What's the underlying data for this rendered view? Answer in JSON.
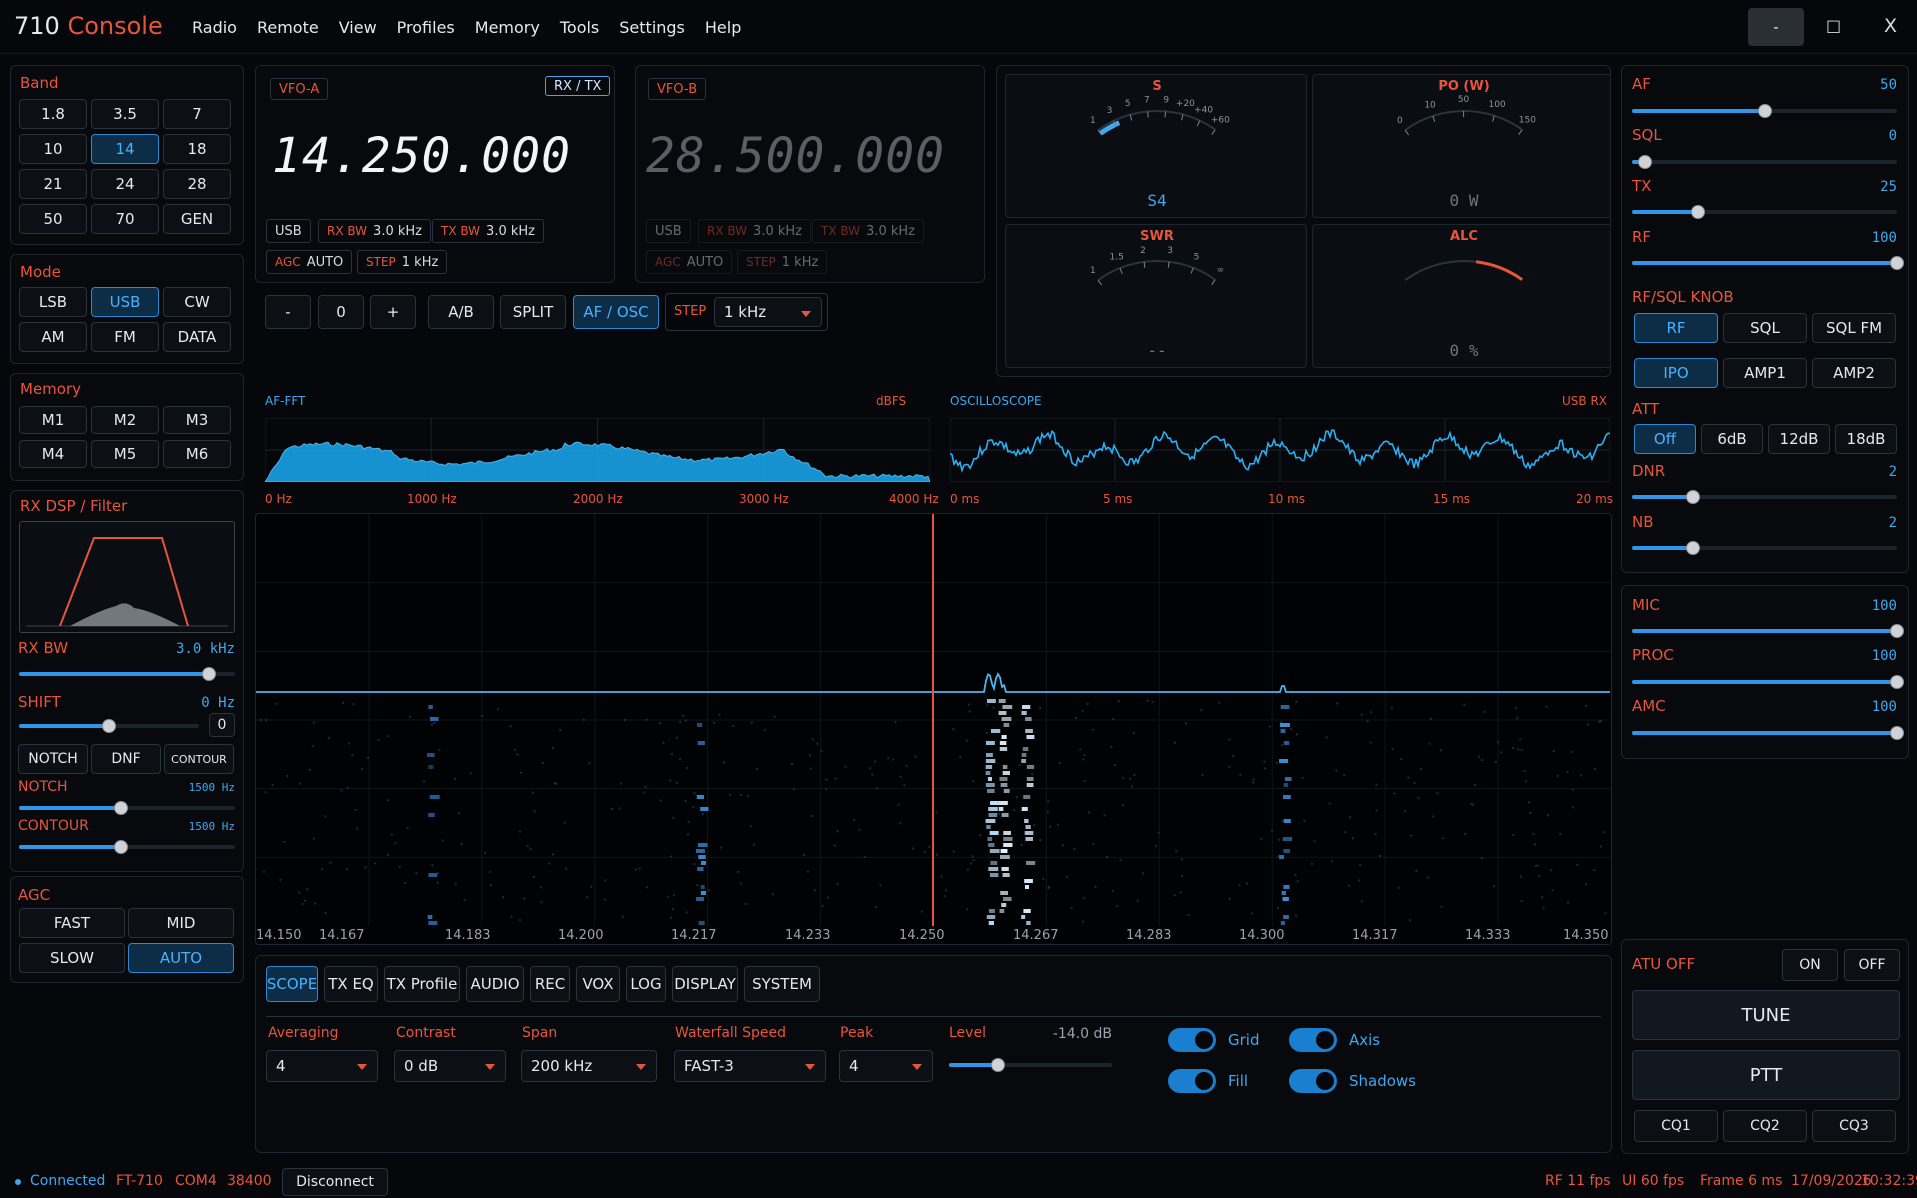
{
  "app": {
    "title_a": "710",
    "title_b": "Console"
  },
  "menu": [
    "Radio",
    "Remote",
    "View",
    "Profiles",
    "Memory",
    "Tools",
    "Settings",
    "Help"
  ],
  "window": {
    "minimize": "-",
    "maximize": "□",
    "close": "X"
  },
  "band": {
    "title": "Band",
    "buttons": [
      "1.8",
      "3.5",
      "7",
      "10",
      "14",
      "18",
      "21",
      "24",
      "28",
      "50",
      "70",
      "GEN"
    ],
    "active": "14"
  },
  "mode": {
    "title": "Mode",
    "buttons": [
      "LSB",
      "USB",
      "CW",
      "AM",
      "FM",
      "DATA"
    ],
    "active": "USB"
  },
  "memory": {
    "title": "Memory",
    "buttons": [
      "M1",
      "M2",
      "M3",
      "M4",
      "M5",
      "M6"
    ]
  },
  "rxdsp": {
    "title": "RX DSP / Filter",
    "rxbw_label": "RX BW",
    "rxbw_value": "3.0 kHz",
    "rxbw_level": 0.88,
    "shift_label": "SHIFT",
    "shift_value": "0 Hz",
    "shift_level": 0.5,
    "shift_box": "0",
    "notch_btn": "NOTCH",
    "dnf_btn": "DNF",
    "contour_btn": "CONTOUR",
    "notch_label": "NOTCH",
    "notch_value": "1500 Hz",
    "notch_level": 0.47,
    "contour_label": "CONTOUR",
    "contour_value": "1500 Hz",
    "contour_level": 0.47
  },
  "agc": {
    "title": "AGC",
    "buttons": [
      "FAST",
      "MID",
      "SLOW",
      "AUTO"
    ],
    "active": "AUTO"
  },
  "vfoa": {
    "tag": "VFO-A",
    "rxtx": "RX / TX",
    "freq": "14.250.000",
    "mode": "USB",
    "rxbw_k": "RX BW",
    "rxbw_v": "3.0 kHz",
    "txbw_k": "TX BW",
    "txbw_v": "3.0 kHz",
    "agc_k": "AGC",
    "agc_v": "AUTO",
    "step_k": "STEP",
    "step_v": "1 kHz"
  },
  "vfob": {
    "tag": "VFO-B",
    "freq": "28.500.000",
    "mode": "USB",
    "rxbw_k": "RX BW",
    "rxbw_v": "3.0 kHz",
    "txbw_k": "TX BW",
    "txbw_v": "3.0 kHz",
    "agc_k": "AGC",
    "agc_v": "AUTO",
    "step_k": "STEP",
    "step_v": "1 kHz"
  },
  "vfoctl": {
    "minus": "-",
    "zero": "0",
    "plus": "+",
    "ab": "A/B",
    "split": "SPLIT",
    "afosc": "AF / OSC",
    "step_label": "STEP",
    "step_value": "1 kHz"
  },
  "meters": {
    "s": {
      "label": "S",
      "value": "S4",
      "ticks": [
        "1",
        "3",
        "5",
        "7",
        "9",
        "+20",
        "+40",
        "+60"
      ],
      "level": 0.18
    },
    "po": {
      "label": "PO (W)",
      "value": "0 W",
      "ticks": [
        "0",
        "10",
        "50",
        "100",
        "150"
      ],
      "level": 0
    },
    "swr": {
      "label": "SWR",
      "value": "--",
      "ticks": [
        "1",
        "1.5",
        "2",
        "3",
        "5",
        "∞"
      ],
      "level": 0
    },
    "alc": {
      "label": "ALC",
      "value": "0 %",
      "level": 0
    }
  },
  "fft": {
    "title": "AF-FFT",
    "unit": "dBFS",
    "x_ticks": [
      "0 Hz",
      "1000 Hz",
      "2000 Hz",
      "3000 Hz",
      "4000 Hz"
    ]
  },
  "osc": {
    "title": "OSCILLOSCOPE",
    "mode": "USB RX",
    "x_ticks": [
      "0 ms",
      "5 ms",
      "10 ms",
      "15 ms",
      "20 ms"
    ]
  },
  "waterfall": {
    "x_ticks": [
      "14.150",
      "14.167",
      "14.183",
      "14.200",
      "14.217",
      "14.233",
      "14.250",
      "14.267",
      "14.283",
      "14.300",
      "14.317",
      "14.333",
      "14.350"
    ],
    "center": "14.250"
  },
  "tabs": {
    "items": [
      "SCOPE",
      "TX EQ",
      "TX Profile",
      "AUDIO",
      "REC",
      "VOX",
      "LOG",
      "DISPLAY",
      "SYSTEM"
    ],
    "active": "SCOPE"
  },
  "scope": {
    "averaging_label": "Averaging",
    "averaging": "4",
    "contrast_label": "Contrast",
    "contrast": "0 dB",
    "span_label": "Span",
    "span": "200 kHz",
    "wf_speed_label": "Waterfall Speed",
    "wf_speed": "FAST-3",
    "peak_label": "Peak",
    "peak": "4",
    "level_label": "Level",
    "level_value": "-14.0 dB",
    "level": 0.3,
    "grid": "Grid",
    "axis": "Axis",
    "fill": "Fill",
    "shadows": "Shadows"
  },
  "right": {
    "af": {
      "label": "AF",
      "value": "50",
      "level": 0.5
    },
    "sql": {
      "label": "SQL",
      "value": "0",
      "level": 0.05
    },
    "tx": {
      "label": "TX",
      "value": "25",
      "level": 0.25
    },
    "rf": {
      "label": "RF",
      "value": "100",
      "level": 1
    },
    "knob_title": "RF/SQL KNOB",
    "knob_buttons": [
      "RF",
      "SQL",
      "SQL FM"
    ],
    "knob_active": "RF",
    "amp_buttons": [
      "IPO",
      "AMP1",
      "AMP2"
    ],
    "amp_active": "IPO",
    "att_title": "ATT",
    "att_buttons": [
      "Off",
      "6dB",
      "12dB",
      "18dB"
    ],
    "att_active": "Off",
    "dnr": {
      "label": "DNR",
      "value": "2",
      "level": 0.23
    },
    "nb": {
      "label": "NB",
      "value": "2",
      "level": 0.23
    },
    "mic": {
      "label": "MIC",
      "value": "100",
      "level": 1
    },
    "proc": {
      "label": "PROC",
      "value": "100",
      "level": 1
    },
    "amc": {
      "label": "AMC",
      "value": "100",
      "level": 1
    },
    "atu": "ATU OFF",
    "on": "ON",
    "off": "OFF",
    "tune": "TUNE",
    "ptt": "PTT",
    "cq": [
      "CQ1",
      "CQ2",
      "CQ3"
    ]
  },
  "status": {
    "connected": "Connected",
    "rig": "FT-710",
    "port": "COM4",
    "baud": "38400",
    "disconnect": "Disconnect",
    "rf_fps": "RF 11 fps",
    "ui_fps": "UI 60 fps",
    "frame": "Frame 6 ms",
    "date": "17/09/2026",
    "time": "10:32:39"
  },
  "colors": {
    "accent": "#3fa8ef",
    "label": "#e8553d",
    "bg": "#05070a"
  }
}
